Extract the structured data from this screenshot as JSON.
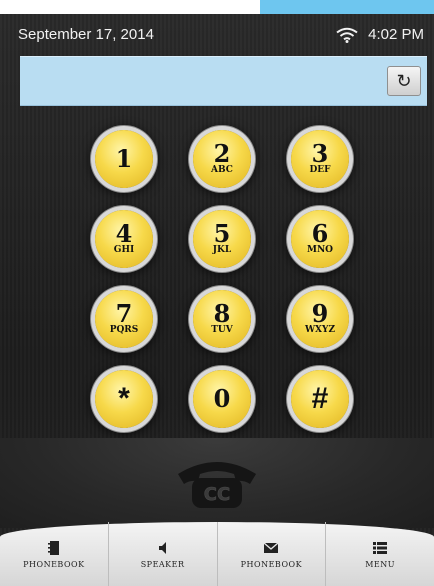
{
  "status": {
    "date": "September 17, 2014",
    "time": "4:02 PM"
  },
  "display": {
    "value": ""
  },
  "keys": [
    {
      "digit": "1",
      "letters": ""
    },
    {
      "digit": "2",
      "letters": "ABC"
    },
    {
      "digit": "3",
      "letters": "DEF"
    },
    {
      "digit": "4",
      "letters": "GHI"
    },
    {
      "digit": "5",
      "letters": "JKL"
    },
    {
      "digit": "6",
      "letters": "MNO"
    },
    {
      "digit": "7",
      "letters": "PQRS"
    },
    {
      "digit": "8",
      "letters": "TUV"
    },
    {
      "digit": "9",
      "letters": "WXYZ"
    },
    {
      "digit": "*",
      "letters": ""
    },
    {
      "digit": "0",
      "letters": ""
    },
    {
      "digit": "#",
      "letters": ""
    }
  ],
  "logo_text": "CC",
  "nav": [
    {
      "label": "PHONEBOOK",
      "icon": "notebook-icon"
    },
    {
      "label": "SPEAKER",
      "icon": "speaker-icon"
    },
    {
      "label": "PHONEBOOK",
      "icon": "envelope-icon"
    },
    {
      "label": "MENU",
      "icon": "list-icon"
    }
  ],
  "colors": {
    "accent": "#6ec6ef",
    "display": "#b9ddf2",
    "key": "#f7d94a",
    "background": "#232323"
  }
}
